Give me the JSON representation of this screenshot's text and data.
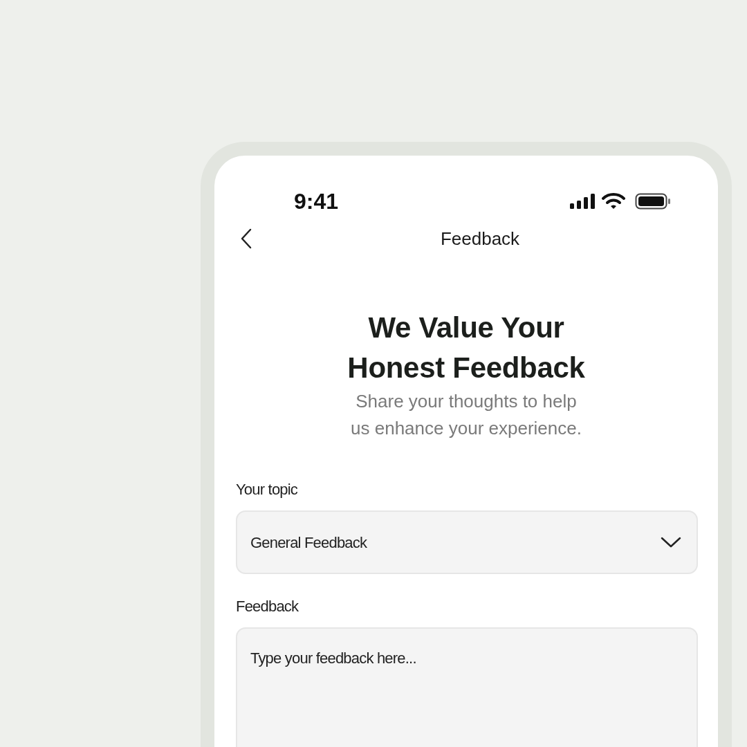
{
  "status_bar": {
    "time": "9:41"
  },
  "nav": {
    "title": "Feedback"
  },
  "hero": {
    "title": "We Value Your Honest Feedback",
    "subtitle": "Share your thoughts to help us enhance your experience."
  },
  "fields": [
    {
      "kind": "select",
      "label": "Your topic",
      "value": "General Feedback"
    },
    {
      "kind": "textarea",
      "label": "Feedback",
      "placeholder": "Type your feedback here..."
    }
  ]
}
